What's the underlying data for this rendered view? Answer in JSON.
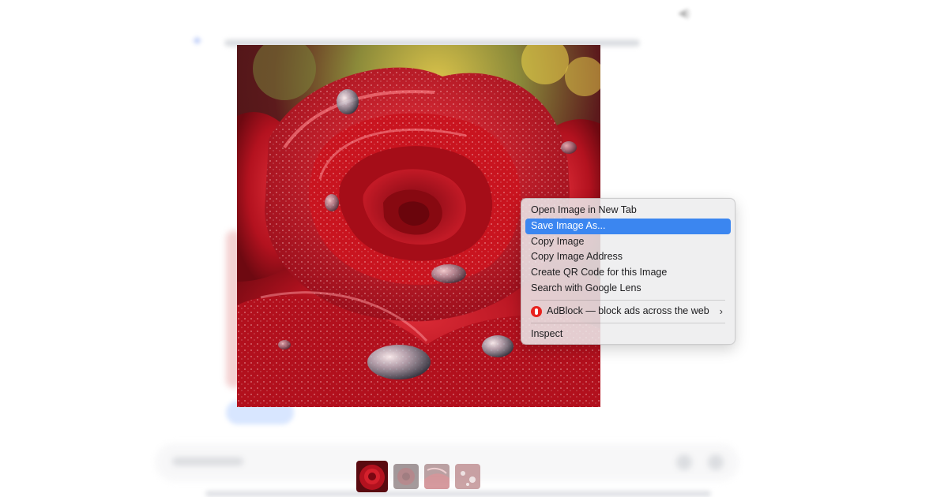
{
  "context_menu": {
    "items": [
      {
        "label": "Open Image in New Tab"
      },
      {
        "label": "Save Image As..."
      },
      {
        "label": "Copy Image"
      },
      {
        "label": "Copy Image Address"
      },
      {
        "label": "Create QR Code for this Image"
      },
      {
        "label": "Search with Google Lens"
      }
    ],
    "extension_item": {
      "label": "AdBlock — block ads across the web",
      "icon": "adblock-icon",
      "submenu_icon": "chevron-right-icon"
    },
    "inspect_label": "Inspect",
    "highlighted_item": "Save Image As...",
    "highlight_color": "#3b86f0"
  },
  "image": {
    "subject": "red rose with water droplets",
    "accent_color": "#c8102e"
  },
  "thumbnails": {
    "count": 4,
    "active_index": 0
  }
}
